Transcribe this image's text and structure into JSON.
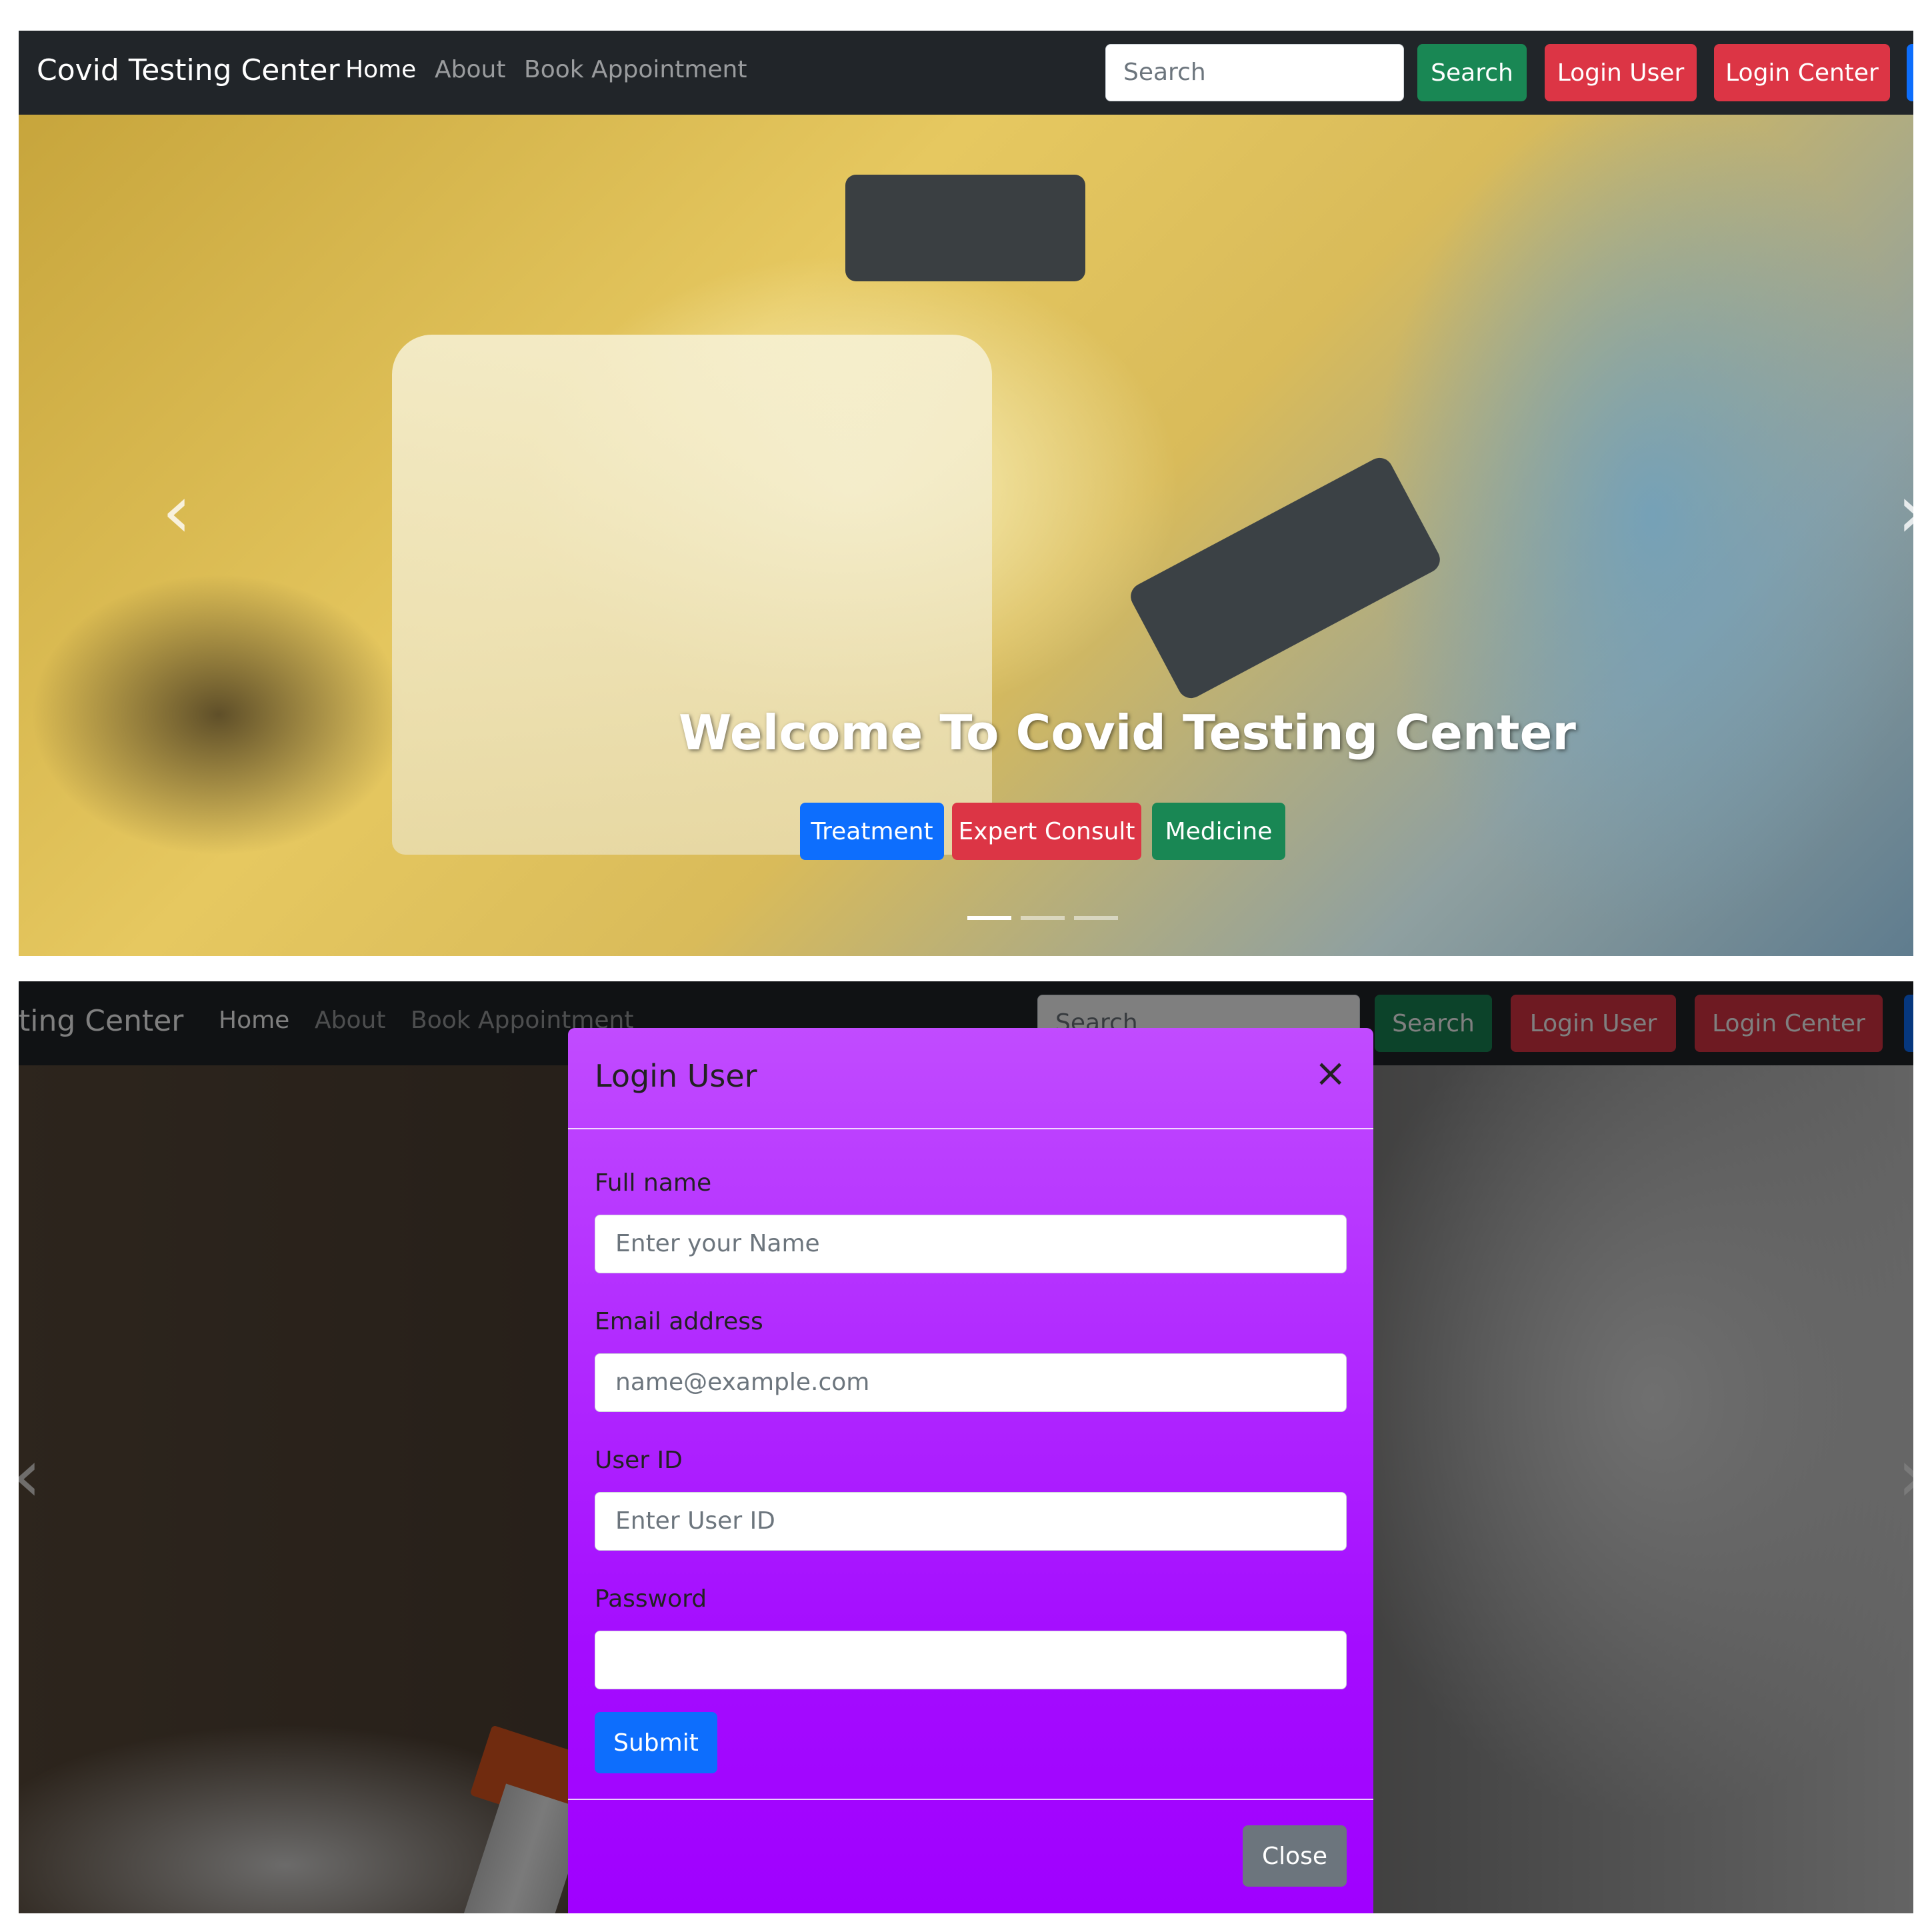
{
  "navbar": {
    "brand": "Covid Testing Center",
    "brand_cropped": "ting Center",
    "links": [
      "Home",
      "About",
      "Book Appointment"
    ],
    "search_placeholder": "Search",
    "search_button": "Search",
    "login_user_button": "Login User",
    "login_center_button": "Login Center"
  },
  "hero": {
    "title": "Welcome To Covid Testing Center",
    "buttons": [
      "Treatment",
      "Expert Consult",
      "Medicine"
    ],
    "prev_arrow": "‹",
    "next_arrow": "›"
  },
  "modal": {
    "title": "Login User",
    "close_icon": "×",
    "fields": [
      {
        "label": "Full name",
        "placeholder": "Enter your Name"
      },
      {
        "label": "Email address",
        "placeholder": "name@example.com"
      },
      {
        "label": "User ID",
        "placeholder": "Enter User ID"
      },
      {
        "label": "Password",
        "placeholder": ""
      }
    ],
    "submit_button": "Submit",
    "close_button": "Close"
  },
  "colors": {
    "navbar": "#212529",
    "success": "#198754",
    "danger": "#dc3545",
    "primary": "#0d6efd",
    "secondary": "#6c757d",
    "modal_purple": "#a000ff"
  }
}
